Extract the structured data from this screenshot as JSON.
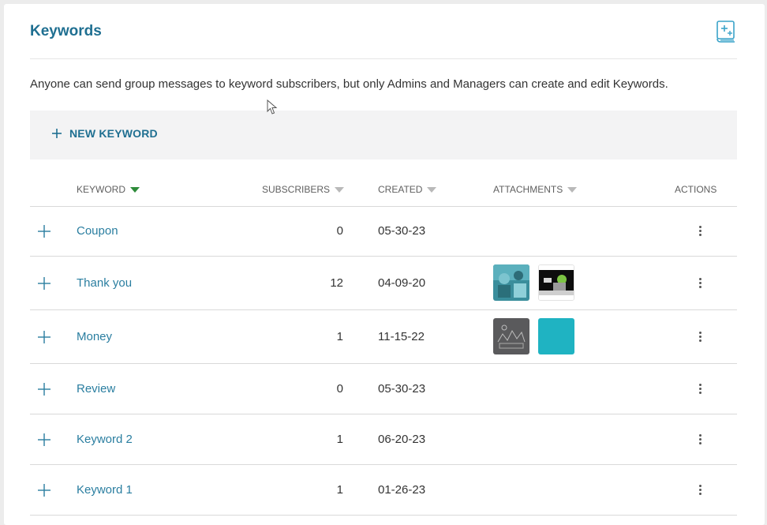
{
  "header": {
    "title": "Keywords",
    "help_icon": "book-plus-icon"
  },
  "description": "Anyone can send group messages to keyword subscribers, but only Admins and Managers can create and edit Keywords.",
  "toolbar": {
    "new_keyword_label": "NEW KEYWORD"
  },
  "table": {
    "columns": {
      "keyword": "KEYWORD",
      "subscribers": "SUBSCRIBERS",
      "created": "CREATED",
      "attachments": "ATTACHMENTS",
      "actions": "ACTIONS"
    },
    "sorted_by": "keyword",
    "rows": [
      {
        "keyword": "Coupon",
        "subscribers": "0",
        "created": "05-30-23",
        "attachments": []
      },
      {
        "keyword": "Thank you",
        "subscribers": "12",
        "created": "04-09-20",
        "attachments": [
          "photo-teal",
          "photo-dark"
        ]
      },
      {
        "keyword": "Money",
        "subscribers": "1",
        "created": "11-15-22",
        "attachments": [
          "photo-gray",
          "color-teal"
        ]
      },
      {
        "keyword": "Review",
        "subscribers": "0",
        "created": "05-30-23",
        "attachments": []
      },
      {
        "keyword": "Keyword 2",
        "subscribers": "1",
        "created": "06-20-23",
        "attachments": []
      },
      {
        "keyword": "Keyword 1",
        "subscribers": "1",
        "created": "01-26-23",
        "attachments": []
      }
    ]
  },
  "colors": {
    "title": "#1f6f91",
    "link": "#2a7ea0",
    "sort_active": "#2e8b3a",
    "sort_inactive": "#b9b9b9",
    "toolbar_bg": "#f3f3f4",
    "attachment_teal": "#1fb3c2"
  }
}
